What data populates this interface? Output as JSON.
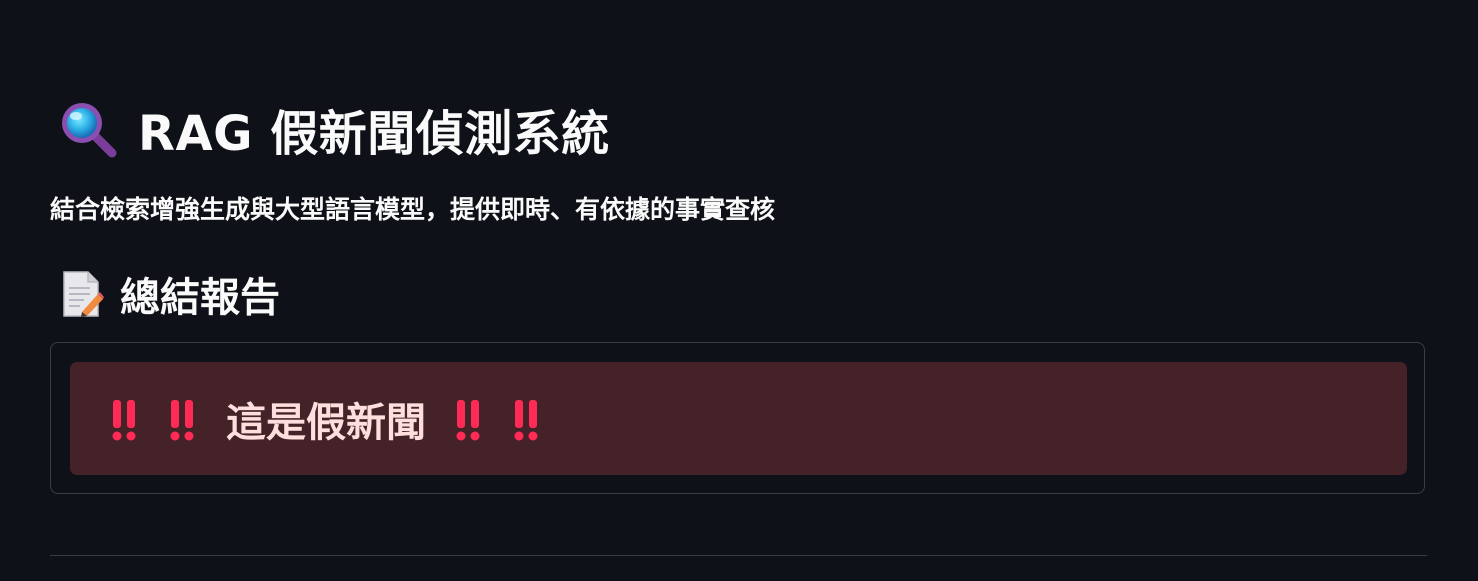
{
  "header": {
    "title": "RAG 假新聞偵測系統",
    "title_icon": "magnifying-glass-icon",
    "subtitle": "結合檢索增強生成與大型語言模型，提供即時、有依據的事實查核"
  },
  "summary": {
    "heading": "總結報告",
    "heading_icon": "memo-icon",
    "verdict_text": "這是假新聞",
    "verdict_icon": "double-exclamation-icon"
  },
  "colors": {
    "background": "#0e1117",
    "alert_background": "#452228",
    "alert_text": "#ffdede",
    "exclamation": "#ff2a55",
    "border": "#3a3d45"
  }
}
